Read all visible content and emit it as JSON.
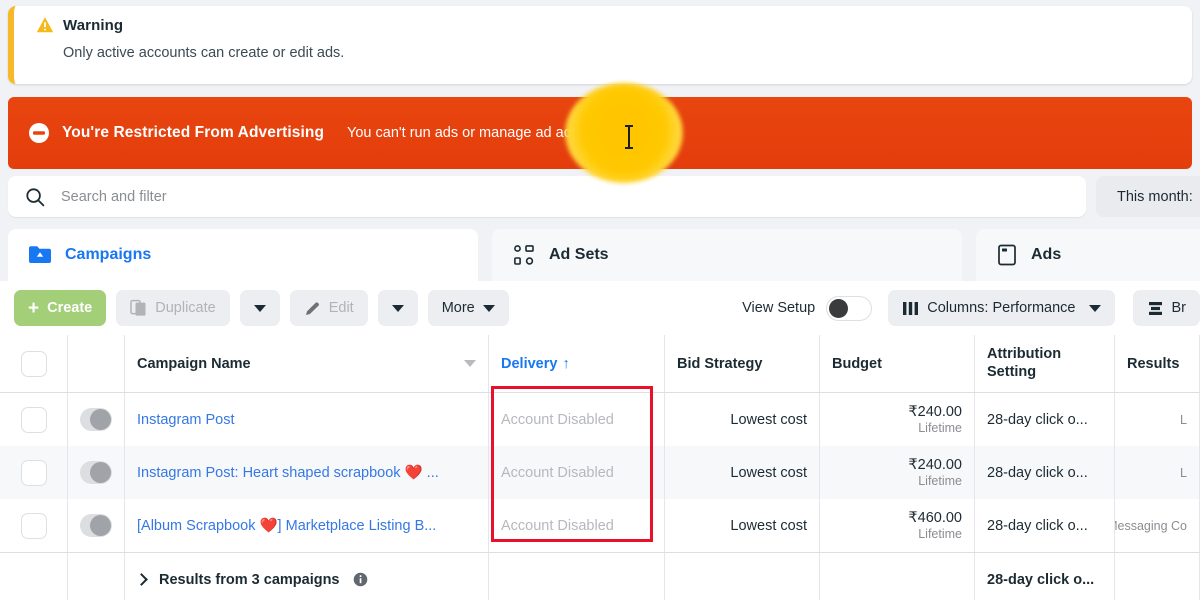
{
  "warning": {
    "icon": "warning-triangle-icon",
    "title": "Warning",
    "message": "Only active accounts can create or edit ads.",
    "accent_color": "#f7b928"
  },
  "restriction_banner": {
    "icon": "block-circle-icon",
    "title": "You're Restricted From Advertising",
    "message": "You can't run ads or manage ad accounts.",
    "background_color": "#e8430f",
    "cursor": "i-beam-text-cursor",
    "highlight": "gold-click-highlight"
  },
  "search": {
    "icon": "search-icon",
    "placeholder": "Search and filter",
    "value": ""
  },
  "date_filter": {
    "label": "This month:"
  },
  "tabs": [
    {
      "label": "Campaigns",
      "icon": "campaigns-folder-icon",
      "active": true
    },
    {
      "label": "Ad Sets",
      "icon": "grid-four-squares-icon",
      "active": false
    },
    {
      "label": "Ads",
      "icon": "ad-document-icon",
      "active": false
    }
  ],
  "toolbar": {
    "create_label": "Create",
    "create_icon": "plus-icon",
    "duplicate_label": "Duplicate",
    "duplicate_icon": "duplicate-pages-icon",
    "edit_label": "Edit",
    "edit_icon": "pencil-icon",
    "more_label": "More",
    "view_setup_label": "View Setup",
    "view_setup_on": false,
    "columns_label": "Columns: Performance",
    "columns_icon": "columns-bars-icon",
    "breakdown_label": "Br",
    "breakdown_icon": "breakdown-bars-icon"
  },
  "table": {
    "headers": {
      "campaign_name": "Campaign Name",
      "delivery": "Delivery",
      "delivery_sort": "↑",
      "bid_strategy": "Bid Strategy",
      "budget": "Budget",
      "attribution_line1": "Attribution",
      "attribution_line2": "Setting",
      "results": "Results"
    },
    "rows": [
      {
        "name": "Instagram Post",
        "delivery": "Account Disabled",
        "bid_strategy": "Lowest cost",
        "budget_amount": "₹240.00",
        "budget_type": "Lifetime",
        "attribution": "28-day click o...",
        "results": "L"
      },
      {
        "name": "Instagram Post: Heart shaped scrapbook ❤️ ...",
        "delivery": "Account Disabled",
        "bid_strategy": "Lowest cost",
        "budget_amount": "₹240.00",
        "budget_type": "Lifetime",
        "attribution": "28-day click o...",
        "results": "L"
      },
      {
        "name": "[Album Scrapbook ❤️] Marketplace Listing B...",
        "delivery": "Account Disabled",
        "bid_strategy": "Lowest cost",
        "budget_amount": "₹460.00",
        "budget_type": "Lifetime",
        "attribution": "28-day click o...",
        "results": "Messaging Co"
      }
    ],
    "summary": {
      "label": "Results from 3 campaigns",
      "info_icon": "info-circle-icon",
      "attribution": "28-day click o..."
    },
    "annotation": {
      "shape": "red-rectangle",
      "color": "#e8102a",
      "target": "delivery-column-cells"
    }
  }
}
